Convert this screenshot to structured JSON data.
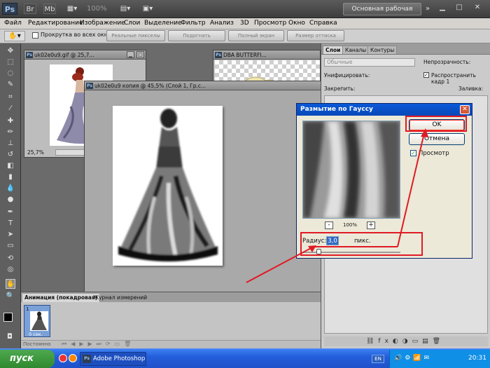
{
  "app": {
    "logo": "Ps",
    "zoom": "100%",
    "workspace_label": "Основная рабочая среда"
  },
  "menu": [
    "Файл",
    "Редактирование",
    "Изображение",
    "Слои",
    "Выделение",
    "Фильтр",
    "Анализ",
    "3D",
    "Просмотр",
    "Окно",
    "Справка"
  ],
  "options": {
    "scroll_all": "Прокрутка во всех окнах",
    "buttons": [
      "Реальные пикселы",
      "Подогнать",
      "Полный экран",
      "Размер оттиска"
    ]
  },
  "docs": {
    "doc1_title": "uk02e0u9.gif @ 25,7...",
    "doc1_zoom": "25,7%",
    "doc2_title": "uk02e0u9 копия @ 45,5% (Слой 1, Гр.с...",
    "doc3_title": "DBA BUTTERFI..."
  },
  "panels": {
    "tabs": [
      "Слои",
      "Каналы",
      "Контуры"
    ],
    "blend_mode": "Обычные",
    "opacity_label": "Непрозрачность:",
    "unify_label": "Унифицировать:",
    "spread_label": "Распространить кадр 1",
    "lock_label": "Закрепить:",
    "fill_label": "Заливка:"
  },
  "dialog": {
    "title": "Размытие по Гауссу",
    "ok": "OK",
    "cancel": "Отмена",
    "preview_label": "Просмотр",
    "preview_checked": true,
    "zoom_minus": "-",
    "zoom_plus": "+",
    "zoom_value": "100%",
    "radius_label": "Радиус:",
    "radius_value": "3,0",
    "radius_unit": "пикс."
  },
  "animation": {
    "tab1": "Анимация (покадровая)",
    "tab2": "Журнал измерений",
    "frame_number": "1",
    "frame_delay": "0 сек.",
    "loop": "Постоянно"
  },
  "taskbar": {
    "start": "пуск",
    "task": "Adobe Photoshop CS...",
    "lang": "EN",
    "time": "20:31"
  },
  "colors": {
    "annotation": "#e01b24",
    "xp_blue": "#0a5ad8",
    "taskbar": "#245edb"
  }
}
